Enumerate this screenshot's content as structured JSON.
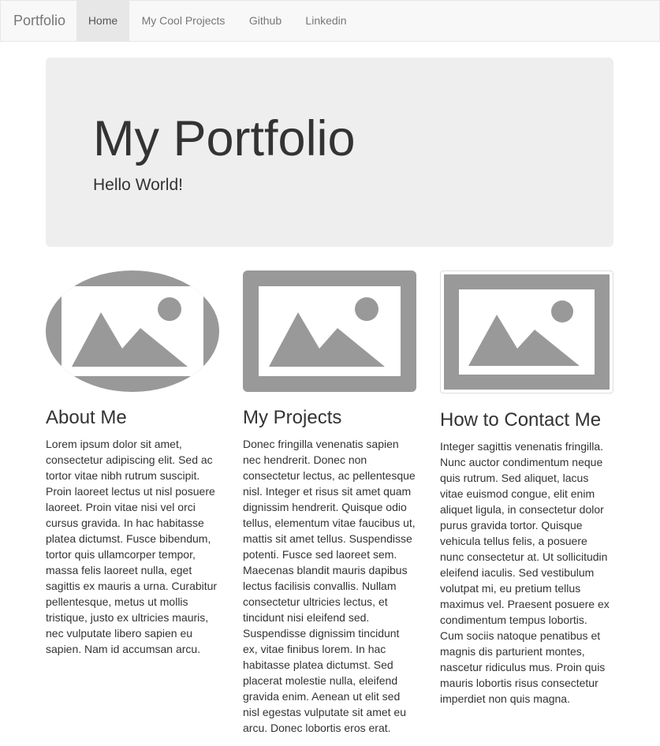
{
  "navbar": {
    "brand": "Portfolio",
    "links": [
      {
        "label": "Home",
        "active": true
      },
      {
        "label": "My Cool Projects",
        "active": false
      },
      {
        "label": "Github",
        "active": false
      },
      {
        "label": "Linkedin",
        "active": false
      }
    ]
  },
  "jumbotron": {
    "title": "My Portfolio",
    "subtitle": "Hello World!"
  },
  "columns": [
    {
      "heading": "About Me",
      "image_icon": "image-placeholder-icon",
      "text": "Lorem ipsum dolor sit amet, consectetur adipiscing elit. Sed ac tortor vitae nibh rutrum suscipit. Proin laoreet lectus ut nisl posuere laoreet. Proin vitae nisi vel orci cursus gravida. In hac habitasse platea dictumst. Fusce bibendum, tortor quis ullamcorper tempor, massa felis laoreet nulla, eget sagittis ex mauris a urna. Curabitur pellentesque, metus ut mollis tristique, justo ex ultricies mauris, nec vulputate libero sapien eu sapien. Nam id accumsan arcu."
    },
    {
      "heading": "My Projects",
      "image_icon": "image-placeholder-icon",
      "text": "Donec fringilla venenatis sapien nec hendrerit. Donec non consectetur lectus, ac pellentesque nisl. Integer et risus sit amet quam dignissim hendrerit. Quisque odio tellus, elementum vitae faucibus ut, mattis sit amet tellus. Suspendisse potenti. Fusce sed laoreet sem. Maecenas blandit mauris dapibus lectus facilisis convallis. Nullam consectetur ultricies lectus, et tincidunt nisi eleifend sed. Suspendisse dignissim tincidunt ex, vitae finibus lorem. In hac habitasse platea dictumst. Sed placerat molestie nulla, eleifend gravida enim. Aenean ut elit sed nisl egestas vulputate sit amet eu arcu. Donec lobortis eros erat."
    },
    {
      "heading": "How to Contact Me",
      "image_icon": "image-placeholder-icon",
      "text": "Integer sagittis venenatis fringilla. Nunc auctor condimentum neque quis rutrum. Sed aliquet, lacus vitae euismod congue, elit enim aliquet ligula, in consectetur dolor purus gravida tortor. Quisque vehicula tellus felis, a posuere nunc consectetur at. Ut sollicitudin eleifend iaculis. Sed vestibulum volutpat mi, eu pretium tellus maximus vel. Praesent posuere ex condimentum tempus lobortis. Cum sociis natoque penatibus et magnis dis parturient montes, nascetur ridiculus mus. Proin quis mauris lobortis risus consectetur imperdiet non quis magna."
    }
  ],
  "colors": {
    "navbar_bg": "#f8f8f8",
    "navbar_active_bg": "#e7e7e7",
    "jumbotron_bg": "#eeeeee",
    "placeholder_gray": "#999999",
    "text": "#333333"
  }
}
